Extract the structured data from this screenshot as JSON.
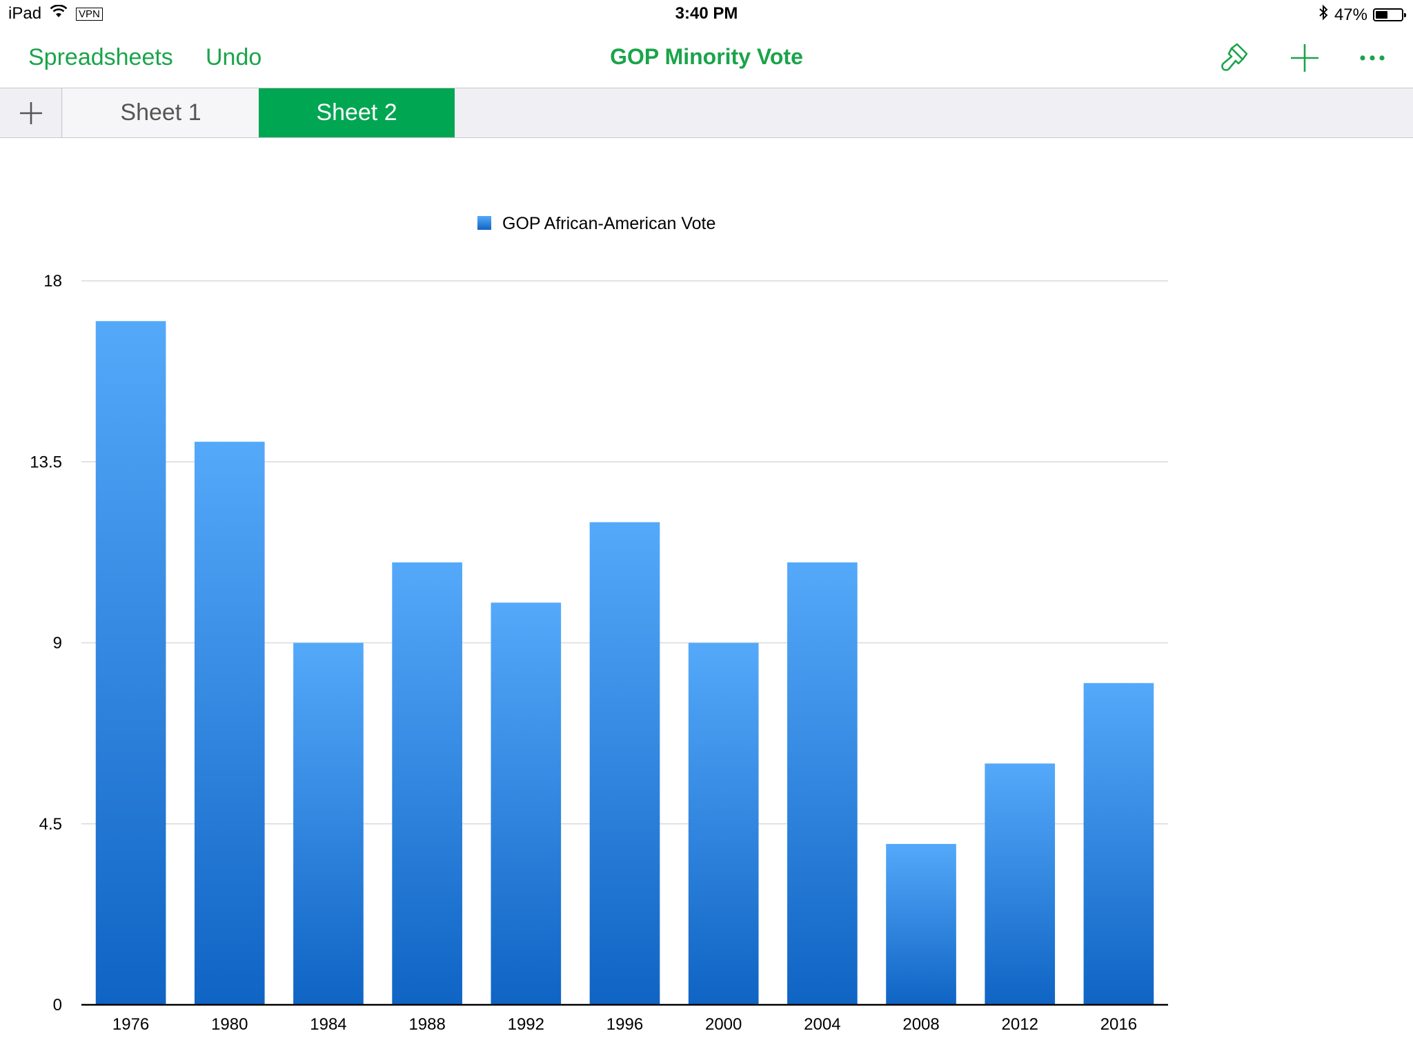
{
  "status_bar": {
    "device": "iPad",
    "vpn": "VPN",
    "time": "3:40 PM",
    "battery_text": "47%",
    "battery_level": 0.47
  },
  "nav": {
    "back_label": "Spreadsheets",
    "undo_label": "Undo",
    "title": "GOP Minority Vote",
    "accent": "#1aa44a"
  },
  "tabs": [
    {
      "label": "Sheet 1",
      "active": false
    },
    {
      "label": "Sheet 2",
      "active": true
    }
  ],
  "chart_data": {
    "type": "bar",
    "categories": [
      "1976",
      "1980",
      "1984",
      "1988",
      "1992",
      "1996",
      "2000",
      "2004",
      "2008",
      "2012",
      "2016"
    ],
    "series": [
      {
        "name": "GOP African-American Vote",
        "values": [
          17,
          14,
          9,
          11,
          10,
          12,
          9,
          11,
          4,
          6,
          8
        ]
      }
    ],
    "ylim": [
      0,
      18
    ],
    "yticks": [
      "0",
      "4.5",
      "9",
      "13.5",
      "18"
    ],
    "grid": true,
    "legend": "top-center",
    "bar_color_top": "#55a9fa",
    "bar_color_bottom": "#0f64c4"
  }
}
